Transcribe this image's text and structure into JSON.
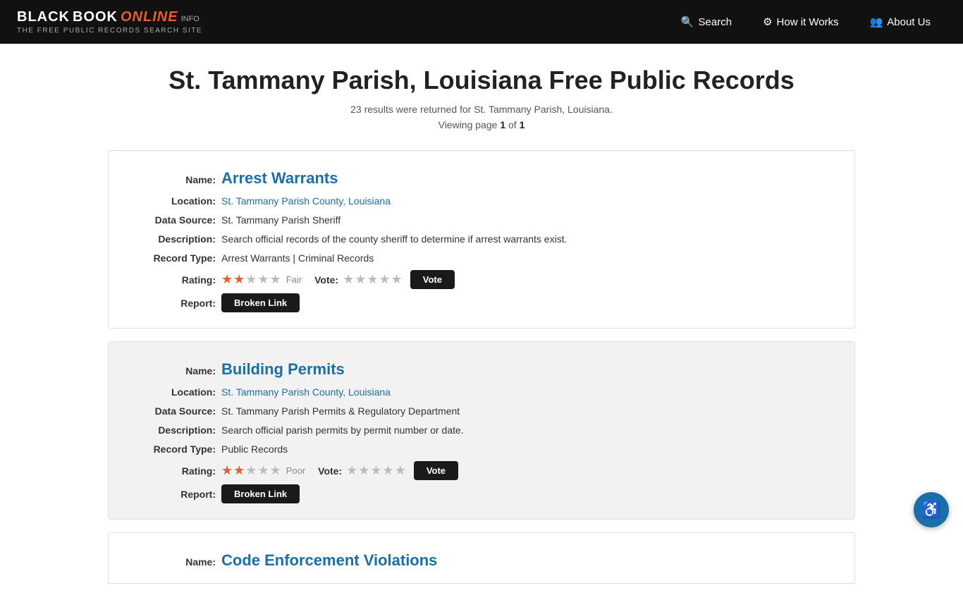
{
  "site": {
    "logo_black": "BLACK",
    "logo_book": "BOOK",
    "logo_online": "ONLINE",
    "logo_info": "INFO",
    "logo_sub": "THE FREE PUBLIC RECORDS SEARCH SITE"
  },
  "nav": {
    "search_label": "Search",
    "how_label": "How it Works",
    "about_label": "About Us"
  },
  "page": {
    "title": "St. Tammany Parish, Louisiana Free Public Records",
    "results_text": "23 results were returned for St. Tammany Parish, Louisiana.",
    "viewing_prefix": "Viewing page",
    "page_current": "1",
    "page_of": "of",
    "page_total": "1"
  },
  "records": [
    {
      "name": "Arrest Warrants",
      "location": "St. Tammany Parish County, Louisiana",
      "data_source": "St. Tammany Parish Sheriff",
      "description": "Search official records of the county sheriff to determine if arrest warrants exist.",
      "record_type": "Arrest Warrants | Criminal Records",
      "rating_filled": 2,
      "rating_empty": 3,
      "rating_text": "Fair",
      "vote_stars": 5,
      "card_bg": "white"
    },
    {
      "name": "Building Permits",
      "location": "St. Tammany Parish County, Louisiana",
      "data_source": "St. Tammany Parish Permits & Regulatory Department",
      "description": "Search official parish permits by permit number or date.",
      "record_type": "Public Records",
      "rating_filled": 2,
      "rating_empty": 3,
      "rating_text": "Poor",
      "vote_stars": 5,
      "card_bg": "gray"
    },
    {
      "name": "Code Enforcement Violations",
      "location": "",
      "data_source": "",
      "description": "",
      "record_type": "",
      "card_bg": "white"
    }
  ],
  "labels": {
    "name": "Name:",
    "location": "Location:",
    "data_source": "Data Source:",
    "description": "Description:",
    "record_type": "Record Type:",
    "rating": "Rating:",
    "report": "Report:",
    "vote": "Vote:",
    "vote_btn": "Vote",
    "broken_link": "Broken Link"
  },
  "accessibility": {
    "icon": "♿"
  }
}
